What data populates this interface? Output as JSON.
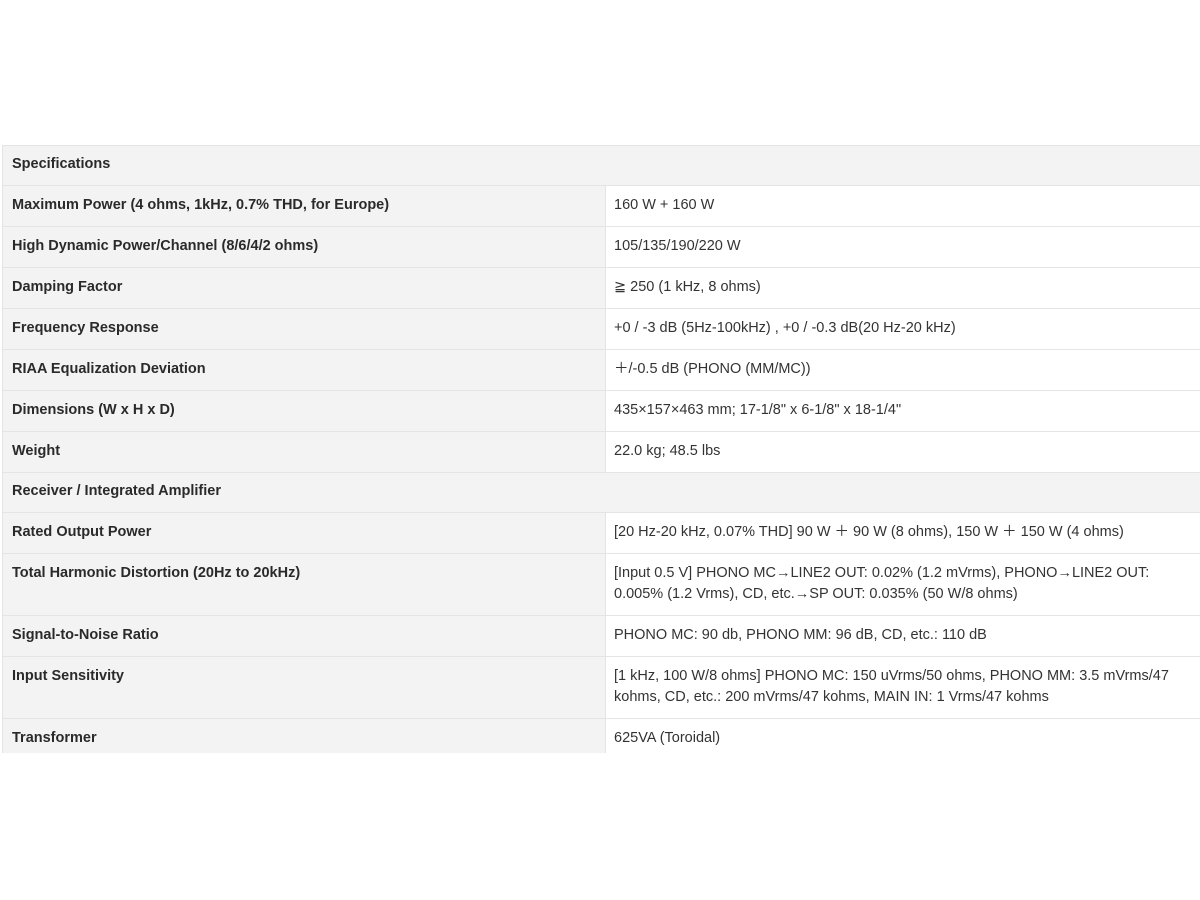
{
  "sections": [
    {
      "title": "Specifications",
      "rows": [
        {
          "label": "Maximum Power (4 ohms, 1kHz, 0.7% THD, for Europe)",
          "value": "160 W + 160 W"
        },
        {
          "label": "High Dynamic Power/Channel (8/6/4/2 ohms)",
          "value": "105/135/190/220 W"
        },
        {
          "label": "Damping Factor",
          "value": "≧ 250 (1 kHz, 8 ohms)"
        },
        {
          "label": "Frequency Response",
          "value": "+0 / -3 dB (5Hz-100kHz) , +0 / -0.3 dB(20 Hz-20 kHz)"
        },
        {
          "label": "RIAA Equalization Deviation",
          "value": "＋/-0.5 dB (PHONO (MM/MC))"
        },
        {
          "label": "Dimensions (W x H x D)",
          "value": "435×157×463 mm; 17-1/8\" x 6-1/8\" x 18-1/4\""
        },
        {
          "label": "Weight",
          "value": "22.0 kg; 48.5 lbs"
        }
      ]
    },
    {
      "title": "Receiver / Integrated Amplifier",
      "rows": [
        {
          "label": "Rated Output Power",
          "value": "[20 Hz-20 kHz, 0.07% THD] 90 W ＋ 90 W (8 ohms), 150 W ＋ 150 W (4 ohms)"
        },
        {
          "label": "Total Harmonic Distortion (20Hz to 20kHz)",
          "value": "[Input 0.5 V] PHONO MC→LINE2 OUT: 0.02% (1.2 mVrms), PHONO→LINE2 OUT: 0.005% (1.2 Vrms), CD, etc.→SP OUT: 0.035% (50 W/8 ohms)"
        },
        {
          "label": "Signal-to-Noise Ratio",
          "value": "PHONO MC: 90 db, PHONO MM: 96 dB, CD, etc.: 110 dB"
        },
        {
          "label": "Input Sensitivity",
          "value": "[1 kHz, 100 W/8 ohms] PHONO MC: 150 uVrms/50 ohms, PHONO MM: 3.5 mVrms/47 kohms, CD, etc.: 200 mVrms/47 kohms, MAIN IN: 1 Vrms/47 kohms"
        },
        {
          "label": "Transformer",
          "value": "625VA (Toroidal)"
        }
      ]
    }
  ]
}
